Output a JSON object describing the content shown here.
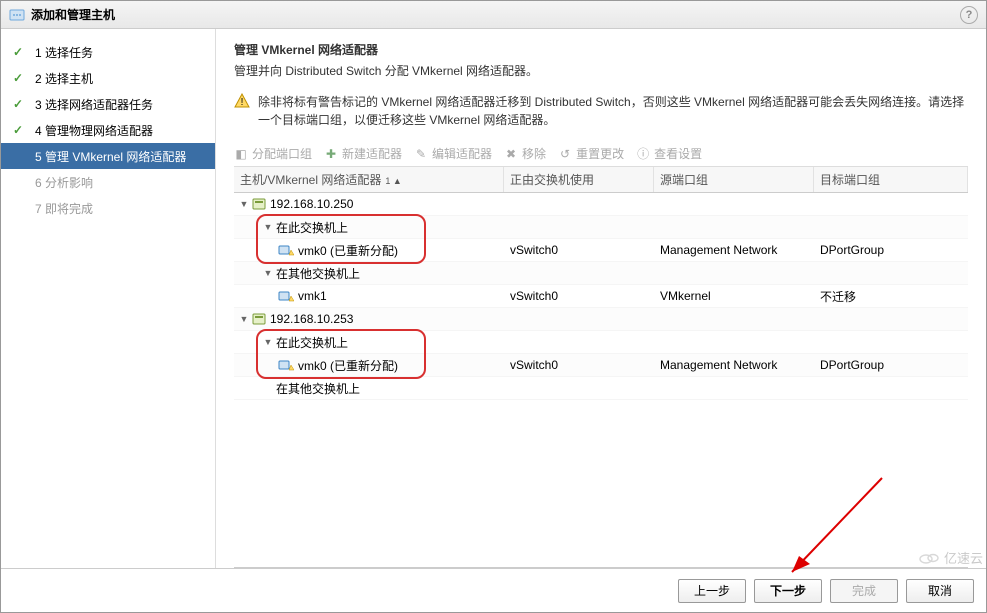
{
  "dialog": {
    "title": "添加和管理主机"
  },
  "sidebar": {
    "steps": [
      {
        "num": "1",
        "label": "选择任务",
        "done": true
      },
      {
        "num": "2",
        "label": "选择主机",
        "done": true
      },
      {
        "num": "3",
        "label": "选择网络适配器任务",
        "done": true
      },
      {
        "num": "4",
        "label": "管理物理网络适配器",
        "done": true
      },
      {
        "num": "5",
        "label": "管理 VMkernel 网络适配器",
        "active": true
      },
      {
        "num": "6",
        "label": "分析影响",
        "disabled": true
      },
      {
        "num": "7",
        "label": "即将完成",
        "disabled": true
      }
    ]
  },
  "main": {
    "title": "管理 VMkernel 网络适配器",
    "desc": "管理并向 Distributed Switch 分配 VMkernel 网络适配器。",
    "warning": "除非将标有警告标记的 VMkernel 网络适配器迁移到 Distributed Switch，否则这些 VMkernel 网络适配器可能会丢失网络连接。请选择一个目标端口组，以便迁移这些 VMkernel 网络适配器。"
  },
  "toolbar": {
    "assign": "分配端口组",
    "newAdapter": "新建适配器",
    "editAdapter": "编辑适配器",
    "remove": "移除",
    "resetChange": "重置更改",
    "viewSettings": "查看设置"
  },
  "grid": {
    "headers": {
      "c0": "主机/VMkernel 网络适配器",
      "c1": "正由交换机使用",
      "c2": "源端口组",
      "c3": "目标端口组"
    },
    "sort_indicator": "1 ▲",
    "labels": {
      "on_this_switch": "在此交换机上",
      "on_other_switch": "在其他交换机上"
    },
    "hosts": [
      {
        "ip": "192.168.10.250",
        "groups": [
          {
            "kind": "on_this_switch",
            "items": [
              {
                "name": "vmk0 (已重新分配)",
                "switch": "vSwitch0",
                "src": "Management Network",
                "dst": "DPortGroup"
              }
            ]
          },
          {
            "kind": "on_other_switch",
            "items": [
              {
                "name": "vmk1",
                "switch": "vSwitch0",
                "src": "VMkernel",
                "dst": "不迁移"
              }
            ]
          }
        ]
      },
      {
        "ip": "192.168.10.253",
        "groups": [
          {
            "kind": "on_this_switch",
            "items": [
              {
                "name": "vmk0 (已重新分配)",
                "switch": "vSwitch0",
                "src": "Management Network",
                "dst": "DPortGroup"
              }
            ]
          },
          {
            "kind": "on_other_switch",
            "items": []
          }
        ]
      }
    ]
  },
  "footer": {
    "back": "上一步",
    "next": "下一步",
    "finish": "完成",
    "cancel": "取消"
  },
  "watermark": "亿速云"
}
